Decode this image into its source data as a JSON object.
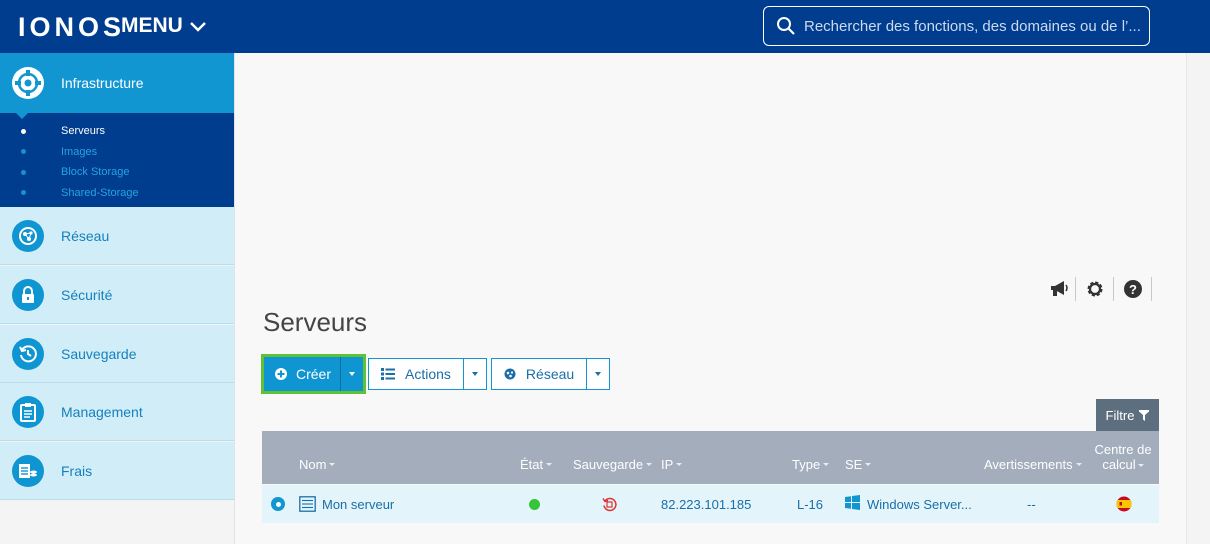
{
  "header": {
    "logo": "IONOS",
    "menu_label": "MENU",
    "search_placeholder": "Rechercher des fonctions, des domaines ou de l’..."
  },
  "sidebar": {
    "active_section": "Infrastructure",
    "submenu": [
      {
        "label": "Serveurs",
        "current": true
      },
      {
        "label": "Images",
        "current": false
      },
      {
        "label": "Block Storage",
        "current": false
      },
      {
        "label": "Shared-Storage",
        "current": false
      }
    ],
    "items": [
      {
        "label": "Réseau",
        "icon": "network-icon"
      },
      {
        "label": "Sécurité",
        "icon": "lock-icon"
      },
      {
        "label": "Sauvegarde",
        "icon": "backup-clock-icon"
      },
      {
        "label": "Management",
        "icon": "clipboard-icon"
      },
      {
        "label": "Frais",
        "icon": "billing-icon"
      }
    ]
  },
  "main": {
    "page_title": "Serveurs",
    "toolbar": {
      "create_label": "Créer",
      "actions_label": "Actions",
      "network_label": "Réseau"
    },
    "filter_label": "Filtre",
    "table": {
      "columns": {
        "name": "Nom",
        "state": "État",
        "backup": "Sauvegarde",
        "ip": "IP",
        "type": "Type",
        "os": "SE",
        "warnings": "Avertissements",
        "datacenter_line1": "Centre de",
        "datacenter_line2": "calcul"
      },
      "rows": [
        {
          "name": "Mon serveur",
          "state": "running",
          "ip": "82.223.101.185",
          "type": "L-16",
          "os": "Windows Server...",
          "warnings": "--",
          "datacenter_flag": "spain-flag-icon"
        }
      ]
    }
  },
  "colors": {
    "header_bg": "#003d8f",
    "accent": "#1196d2",
    "highlight_border": "#5ec234",
    "status_ok": "#35c53b"
  }
}
